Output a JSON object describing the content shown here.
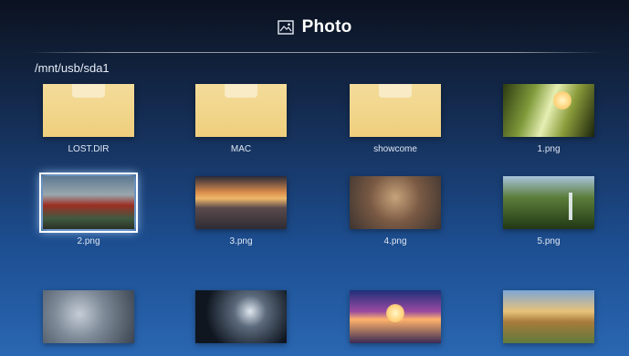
{
  "header": {
    "title": "Photo",
    "icon": "image-icon"
  },
  "path": "/mnt/usb/sda1",
  "items": [
    {
      "label": "LOST.DIR",
      "kind": "folder"
    },
    {
      "label": "MAC",
      "kind": "folder"
    },
    {
      "label": "showcome",
      "kind": "folder"
    },
    {
      "label": "1.png",
      "kind": "photo"
    },
    {
      "label": "2.png",
      "kind": "photo",
      "selected": true
    },
    {
      "label": "3.png",
      "kind": "photo"
    },
    {
      "label": "4.png",
      "kind": "photo"
    },
    {
      "label": "5.png",
      "kind": "photo"
    },
    {
      "label": "",
      "kind": "photo"
    },
    {
      "label": "",
      "kind": "photo"
    },
    {
      "label": "",
      "kind": "photo"
    },
    {
      "label": "",
      "kind": "photo"
    }
  ],
  "colors": {
    "folder": "#efcf7d",
    "selection_glow": "#aad2ff"
  }
}
